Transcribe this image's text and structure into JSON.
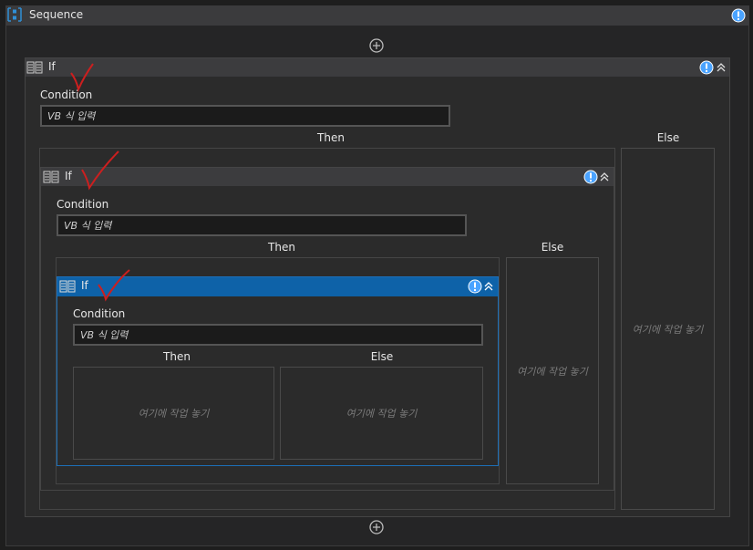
{
  "sequence": {
    "title": "Sequence"
  },
  "if_label": "If",
  "condition_label": "Condition",
  "condition_placeholder": "VB 식 입력",
  "then_label": "Then",
  "else_label": "Else",
  "drop_hint": "여기에 작업 놓기",
  "colors": {
    "selected_header": "#0e62a8",
    "warning": "#4aa3ff",
    "annotation": "#cc1f1f"
  }
}
